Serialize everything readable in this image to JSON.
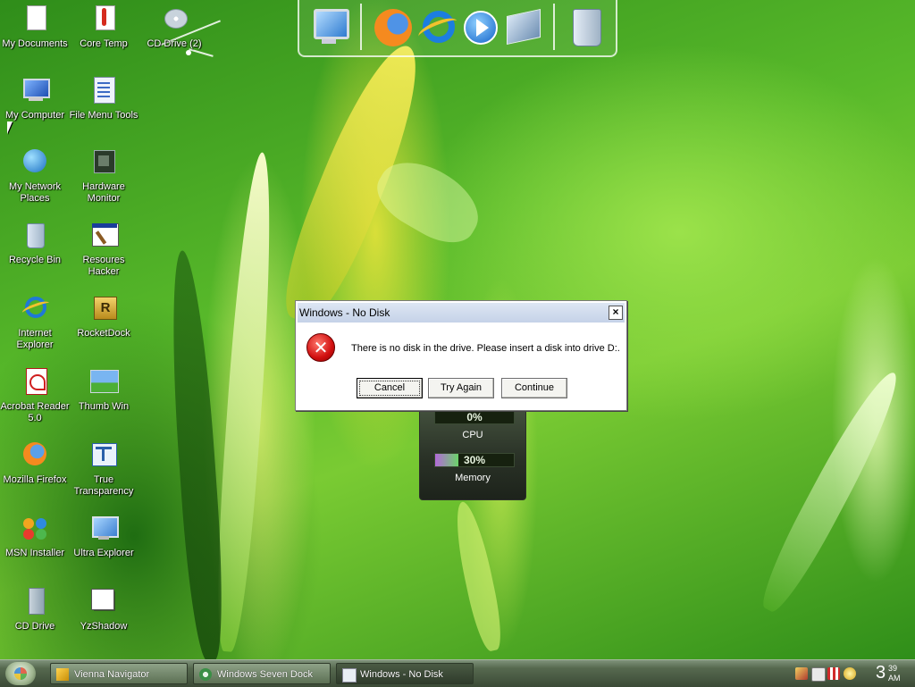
{
  "desktop_icons": [
    {
      "label": "My Documents"
    },
    {
      "label": "Core Temp"
    },
    {
      "label": "CD Drive (2)"
    },
    {
      "label": "My Computer"
    },
    {
      "label": "File Menu Tools"
    },
    {
      "label": "My Network Places"
    },
    {
      "label": "Hardware Monitor"
    },
    {
      "label": "Recycle Bin"
    },
    {
      "label": "Resoures Hacker"
    },
    {
      "label": "Internet Explorer"
    },
    {
      "label": "RocketDock"
    },
    {
      "label": "Acrobat Reader 5.0"
    },
    {
      "label": "Thumb Win"
    },
    {
      "label": "Mozilla Firefox"
    },
    {
      "label": "True Transparency"
    },
    {
      "label": "MSN Installer"
    },
    {
      "label": "Ultra Explorer"
    },
    {
      "label": "CD Drive"
    },
    {
      "label": "YzShadow"
    }
  ],
  "dock_icons": [
    "monitor-icon",
    "firefox-icon",
    "internet-explorer-icon",
    "media-player-icon",
    "control-panel-icon",
    "recycle-bin-icon"
  ],
  "gadget": {
    "cpu_percent_text": "0%",
    "cpu_label": "CPU",
    "memory_percent_text": "30%",
    "memory_label": "Memory",
    "memory_fraction": 0.3
  },
  "dialog": {
    "title": "Windows - No Disk",
    "close_glyph": "×",
    "message": "There is no disk in the drive. Please insert a disk into drive D:.",
    "cancel_label": "Cancel",
    "try_again_label": "Try Again",
    "continue_label": "Continue"
  },
  "taskbar": {
    "buttons": [
      {
        "label": "Vienna Navigator"
      },
      {
        "label": "Windows Seven Dock"
      },
      {
        "label": "Windows - No Disk"
      }
    ],
    "clock_hour": "3",
    "clock_minute": "39",
    "clock_ampm": "AM"
  },
  "colors": {
    "dialog_titlebar": "#c5d2e8",
    "error_red": "#d10f0f",
    "taskbar": "#56694f"
  }
}
